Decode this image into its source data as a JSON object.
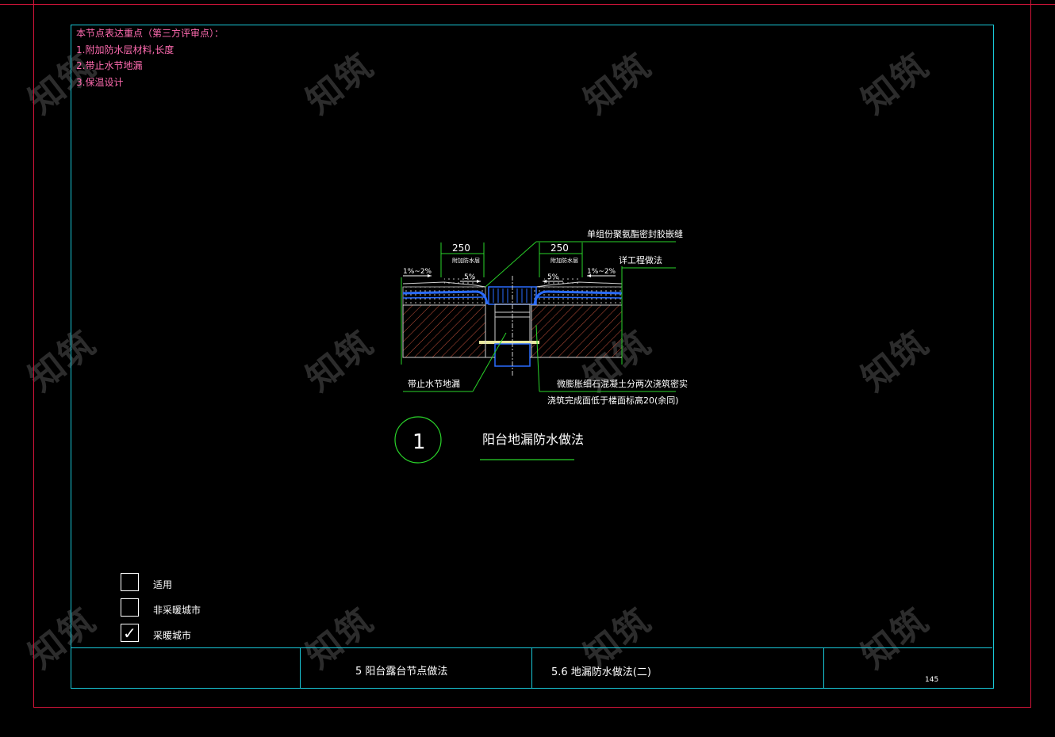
{
  "notes": {
    "heading": "本节点表达重点（第三方评审点）：",
    "items": [
      "1.附加防水层材料,长度",
      "2.带止水节地漏",
      "3.保温设计"
    ]
  },
  "drawing": {
    "dim_left": "250",
    "dim_right": "250",
    "sub_left": "附加防水层",
    "sub_right": "附加防水层",
    "slope_outer_left": "1%~2%",
    "slope_outer_right": "1%~2%",
    "slope_inner_left": "5%",
    "slope_inner_right": "5%",
    "callout_top": "单组份聚氨酯密封胶嵌缝",
    "callout_mid": "详工程做法",
    "callout_left_bottom": "带止水节地漏",
    "callout_right_bottom_1": "微膨胀细石混凝土分两次浇筑密实",
    "callout_right_bottom_2": "浇筑完成面低于楼面标高20(余同)",
    "detail_number": "1",
    "detail_title": "阳台地漏防水做法"
  },
  "legend": {
    "items": [
      {
        "label": "适用",
        "checked": false
      },
      {
        "label": "非采暖城市",
        "checked": false
      },
      {
        "label": "采暖城市",
        "checked": true
      }
    ]
  },
  "title_block": {
    "section": "5  阳台露台节点做法",
    "subsection": "5.6  地漏防水做法(二)",
    "page": "145"
  },
  "watermark": "知筑",
  "colors": {
    "border_red": "#d4143a",
    "border_cyan": "#19c8d8",
    "notes_pink": "#ff6bb0",
    "drawing_green": "#2ad42a",
    "drawing_blue": "#2a6cff",
    "hatch_red": "#c0503a"
  }
}
